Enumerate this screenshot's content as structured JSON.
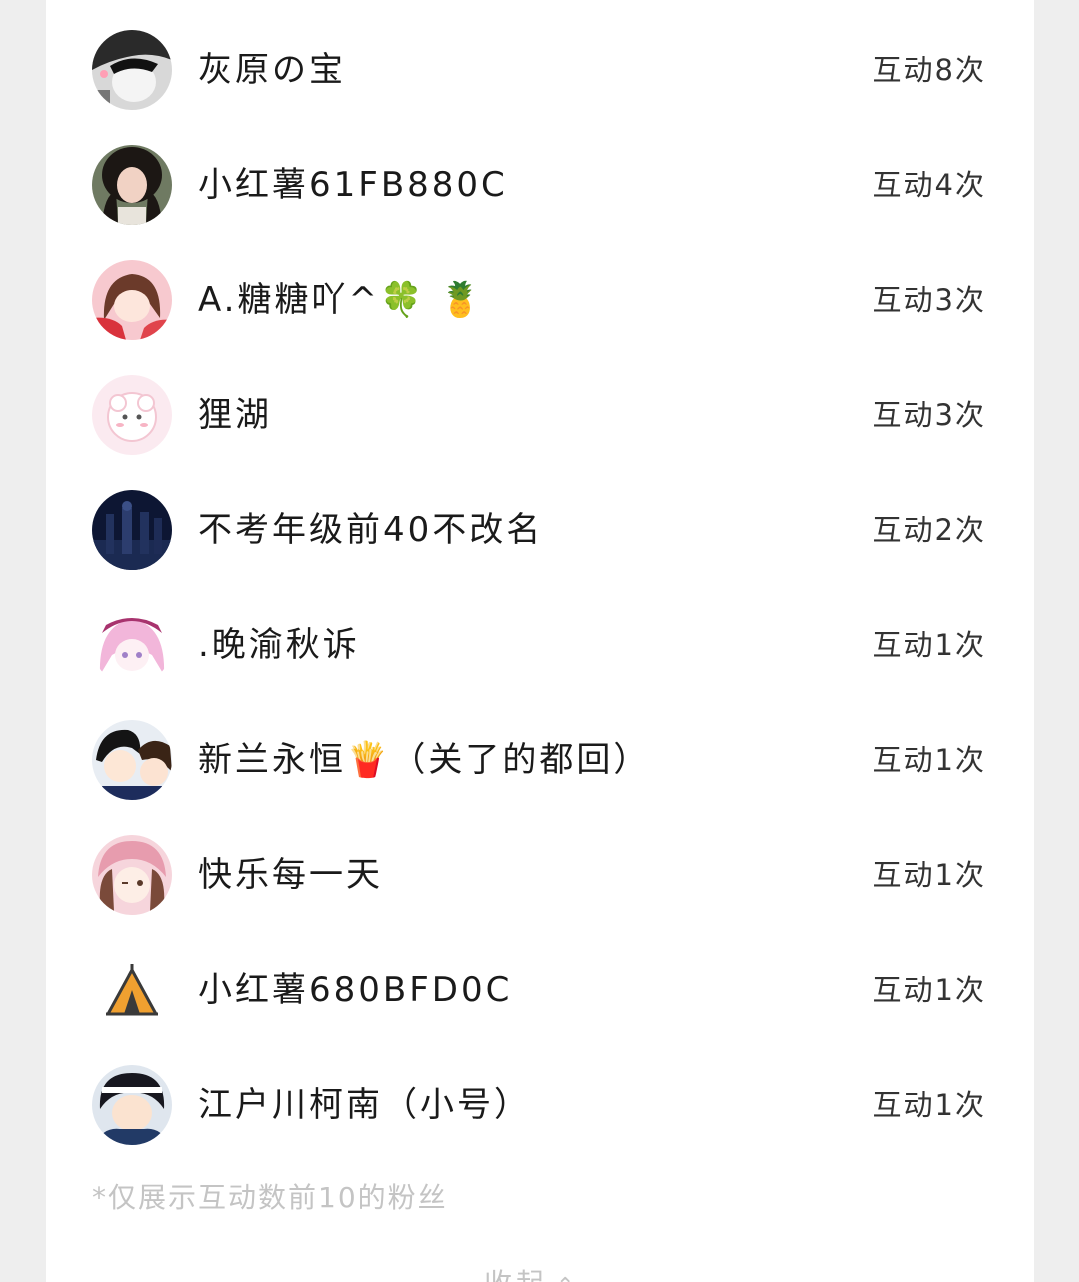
{
  "fans": [
    {
      "name": "灰原の宝",
      "count": "互动8次",
      "avatar_icon": "avatar-bw-manga-icon"
    },
    {
      "name": "小红薯61FB880C",
      "count": "互动4次",
      "avatar_icon": "avatar-selfie-icon"
    },
    {
      "name": "A.糖糖吖^🍀 🍍",
      "count": "互动3次",
      "avatar_icon": "avatar-anime-girl-red-icon"
    },
    {
      "name": "狸湖",
      "count": "互动3次",
      "avatar_icon": "avatar-cute-pastel-icon"
    },
    {
      "name": "不考年级前40不改名",
      "count": "互动2次",
      "avatar_icon": "avatar-dark-anime-icon"
    },
    {
      "name": ".晚渝秋诉",
      "count": "互动1次",
      "avatar_icon": "avatar-pink-hair-icon"
    },
    {
      "name": "新兰永恒🍟（关了的都回）",
      "count": "互动1次",
      "avatar_icon": "avatar-anime-couple-icon"
    },
    {
      "name": "快乐每一天",
      "count": "互动1次",
      "avatar_icon": "avatar-pink-chibi-icon"
    },
    {
      "name": "小红薯680BFD0C",
      "count": "互动1次",
      "avatar_icon": "avatar-tent-icon"
    },
    {
      "name": "江户川柯南（小号）",
      "count": "互动1次",
      "avatar_icon": "avatar-conan-icon"
    }
  ],
  "footnote": "*仅展示互动数前10的粉丝",
  "collapse_label": "收起",
  "colors": {
    "background": "#eeeeee",
    "card": "#ffffff",
    "name_text": "#1a1a1a",
    "count_text": "#333333",
    "muted_text": "#c4c4c4",
    "tent_orange": "#f0a030"
  }
}
